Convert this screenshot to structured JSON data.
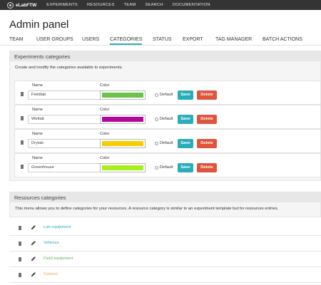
{
  "app": {
    "name": "eLabFTW"
  },
  "nav": [
    "EXPERIMENTS",
    "RESOURCES",
    "TEAM",
    "SEARCH",
    "DOCUMENTATION"
  ],
  "page": {
    "title": "Admin panel"
  },
  "tabs": [
    {
      "label": "TEAM",
      "active": false
    },
    {
      "label": "USER GROUPS",
      "active": false
    },
    {
      "label": "USERS",
      "active": false
    },
    {
      "label": "CATEGORIES",
      "active": true
    },
    {
      "label": "STATUS",
      "active": false
    },
    {
      "label": "EXPORT",
      "active": false
    },
    {
      "label": "TAG MANAGER",
      "active": false
    },
    {
      "label": "BATCH ACTIONS",
      "active": false
    }
  ],
  "experiments": {
    "heading": "Experiments categories",
    "description": "Create and modify the categories available to experiments.",
    "name_label": "Name",
    "color_label": "Color",
    "default_label": "Default",
    "save_label": "Save",
    "delete_label": "Delete",
    "categories": [
      {
        "name": "Fieldlab",
        "color": "#6cc24a"
      },
      {
        "name": "Wetlab",
        "color": "#b5069c"
      },
      {
        "name": "Drylab",
        "color": "#f7cc00"
      },
      {
        "name": "Greenhouse",
        "color": "#a8ef1c"
      }
    ]
  },
  "resources": {
    "heading": "Resources categories",
    "description": "This menu allows you to define categories for your resources. A resource category is similar to an experiment template but for resources entries.",
    "items": [
      {
        "name": "Lab equipment",
        "color": "#29aeb9"
      },
      {
        "name": "Vehicles",
        "color": "#29aeb9"
      },
      {
        "name": "Field equipment",
        "color": "#5cb85c"
      },
      {
        "name": "Dataset",
        "color": "#f0ad4e"
      }
    ]
  }
}
